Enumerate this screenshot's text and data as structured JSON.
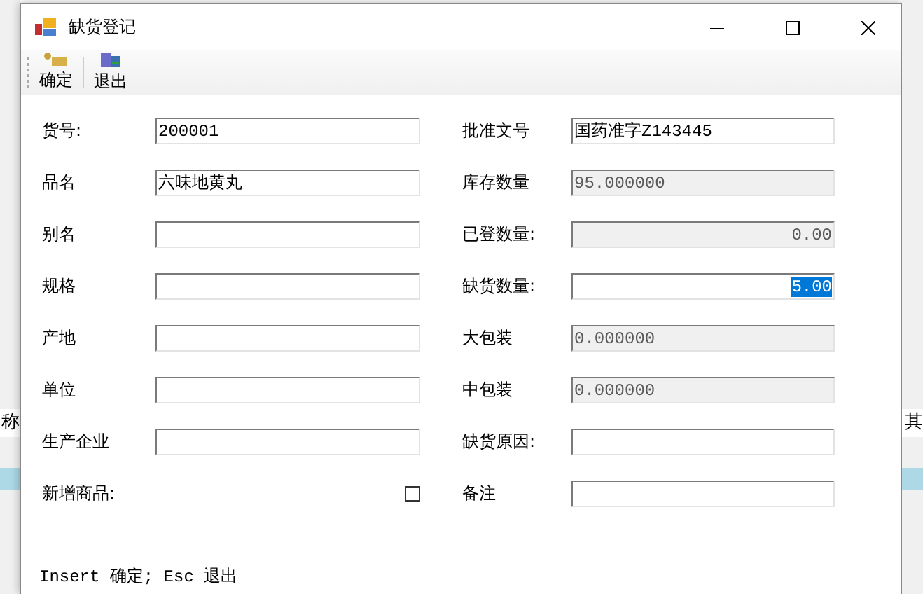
{
  "window": {
    "title": "缺货登记"
  },
  "toolbar": [
    {
      "kind": "confirm",
      "label": "确定"
    },
    {
      "kind": "exit",
      "label": "退出"
    }
  ],
  "left": [
    {
      "kind": "text",
      "label": "货号:",
      "value": "200001"
    },
    {
      "kind": "text",
      "label": "品名",
      "value": "六味地黄丸"
    },
    {
      "kind": "text",
      "label": "别名"
    },
    {
      "kind": "text",
      "label": "规格"
    },
    {
      "kind": "text",
      "label": "产地"
    },
    {
      "kind": "text",
      "label": "单位"
    },
    {
      "kind": "text",
      "label": "生产企业"
    },
    {
      "kind": "checkbox",
      "label": "新增商品:",
      "checked": false
    }
  ],
  "right": [
    {
      "kind": "text",
      "label": "批准文号",
      "value": "国药准字Z143445",
      "disabled": false,
      "numeric": false,
      "selected": false
    },
    {
      "kind": "text",
      "label": "库存数量",
      "value": "95.000000",
      "disabled": true,
      "numeric": false,
      "selected": false
    },
    {
      "kind": "text",
      "label": "已登数量:",
      "value": "0.00",
      "disabled": true,
      "numeric": true,
      "selected": false
    },
    {
      "kind": "text",
      "label": "缺货数量:",
      "value": "5.00",
      "disabled": false,
      "numeric": true,
      "selected": true
    },
    {
      "kind": "text",
      "label": "大包装",
      "value": "0.000000",
      "disabled": true,
      "numeric": false,
      "selected": false
    },
    {
      "kind": "text",
      "label": "中包装",
      "value": "0.000000",
      "disabled": true,
      "numeric": false,
      "selected": false
    },
    {
      "kind": "text",
      "label": "缺货原因:",
      "disabled": false
    },
    {
      "kind": "text",
      "label": "备注",
      "disabled": false
    }
  ],
  "status_bar": "Insert 确定; Esc 退出",
  "background": {
    "left_text": "称",
    "right_text": "其"
  }
}
